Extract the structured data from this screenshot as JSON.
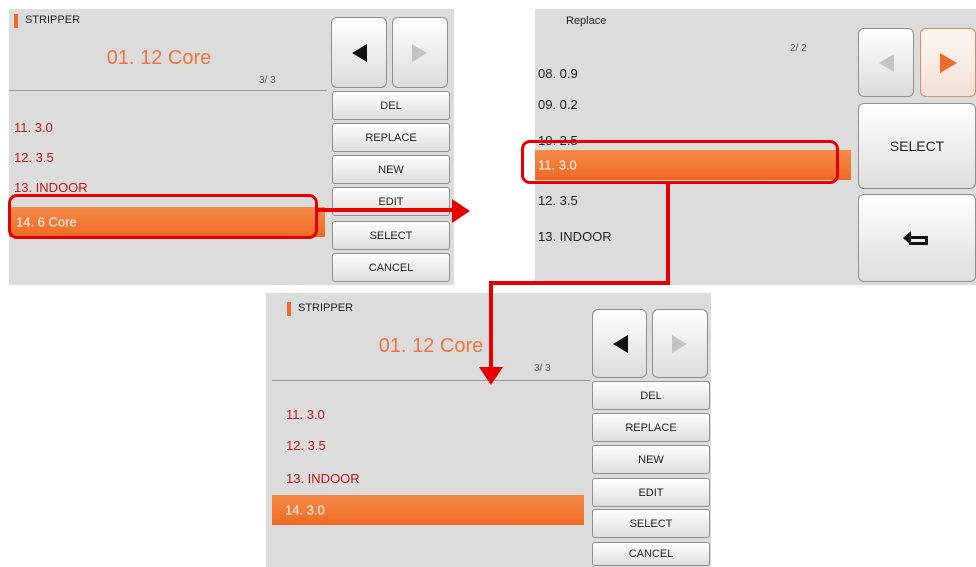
{
  "colors": {
    "accent": "#f06a2a",
    "highlight_red": "#e80000",
    "item_red": "#c01818",
    "panel_bg": "#dcdcdc"
  },
  "panel1": {
    "header": "STRIPPER",
    "title": "01. 12 Core",
    "page": "3/ 3",
    "items": [
      "11. 3.0",
      "12. 3.5",
      "13. INDOOR"
    ],
    "selected": "14. 6 Core",
    "prev_icon": "left-arrow-icon",
    "next_icon": "right-arrow-icon",
    "buttons": {
      "del": "DEL",
      "replace": "REPLACE",
      "new": "NEW",
      "edit": "EDIT",
      "select": "SELECT",
      "cancel": "CANCEL"
    }
  },
  "panel2": {
    "header": "Replace",
    "page": "2/ 2",
    "items_above": [
      "08. 0.9",
      "09. 0.2",
      "10. 2.5"
    ],
    "selected": "11. 3.0",
    "items_below": [
      "12. 3.5",
      "13. INDOOR"
    ],
    "prev_icon": "left-arrow-icon",
    "next_icon": "right-arrow-icon",
    "select_button": "SELECT",
    "back_icon": "return-icon"
  },
  "panel3": {
    "header": "STRIPPER",
    "title": "01. 12 Core",
    "page": "3/ 3",
    "items": [
      "11. 3.0",
      "12. 3.5",
      "13. INDOOR"
    ],
    "selected": "14. 3.0",
    "prev_icon": "left-arrow-icon",
    "next_icon": "right-arrow-icon",
    "buttons": {
      "del": "DEL",
      "replace": "REPLACE",
      "new": "NEW",
      "edit": "EDIT",
      "select": "SELECT",
      "cancel": "CANCEL"
    }
  }
}
